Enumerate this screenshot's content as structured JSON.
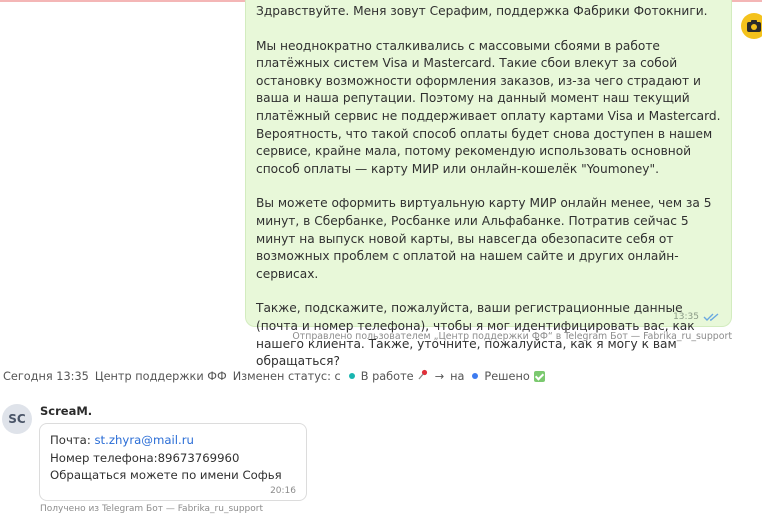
{
  "outgoing_message": {
    "paragraphs": [
      "Здравствуйте. Меня зовут Серафим, поддержка Фабрики Фотокниги.",
      "Мы неоднократно сталкивались с массовыми сбоями в работе платёжных систем Visa и Mastercard. Такие сбои влекут за собой остановку возможности оформления заказов, из-за чего страдают и ваша и наша репутации. Поэтому на данный момент наш текущий платёжный сервис не поддерживает оплату картами Visa и Mastercard. Вероятность, что такой способ оплаты будет снова доступен в нашем сервисе, крайне мала, потому рекомендую использовать основной способ оплаты — карту МИР или онлайн-кошелёк \"Youmoney\".",
      "Вы можете оформить виртуальную карту МИР онлайн менее, чем за 5 минут, в Сбербанке, Росбанке или Альфабанке. Потратив сейчас 5 минут на выпуск новой карты, вы навсегда обезопасите себя от возможных проблем с оплатой на нашем сайте и других онлайн-сервисах.",
      "Также, подскажите, пожалуйста, ваши регистрационные данные (почта и номер телефона), чтобы я мог идентифицировать вас, как нашего клиента. Также, уточните, пожалуйста, как я могу к вам обращаться?"
    ],
    "time": "13:35",
    "sent_note": "Отправлено пользователем „Центр поддержки ФФ“ в Telegram Бот — Fabrika_ru_support"
  },
  "status_change": {
    "date": "Сегодня 13:35",
    "agent": "Центр поддержки ФФ",
    "text": "Изменен статус: с",
    "from_status": "В работе",
    "arrow": "→",
    "to_word": "на",
    "to_status": "Решено"
  },
  "incoming_message": {
    "avatar_initials": "SC",
    "sender": "ScreaM.",
    "email_label": "Почта: ",
    "email": "st.zhyra@mail.ru",
    "phone": "Номер телефона:89673769960",
    "name_line": "Обращаться можете по имени Софья",
    "time": "20:16",
    "received_note": "Получено из Telegram Бот — Fabrika_ru_support"
  },
  "colors": {
    "outgoing_bubble": "#e8f8d9",
    "status_in_progress": "#19b5b0",
    "status_resolved": "#3d7bf0",
    "link": "#2a6dd6"
  }
}
